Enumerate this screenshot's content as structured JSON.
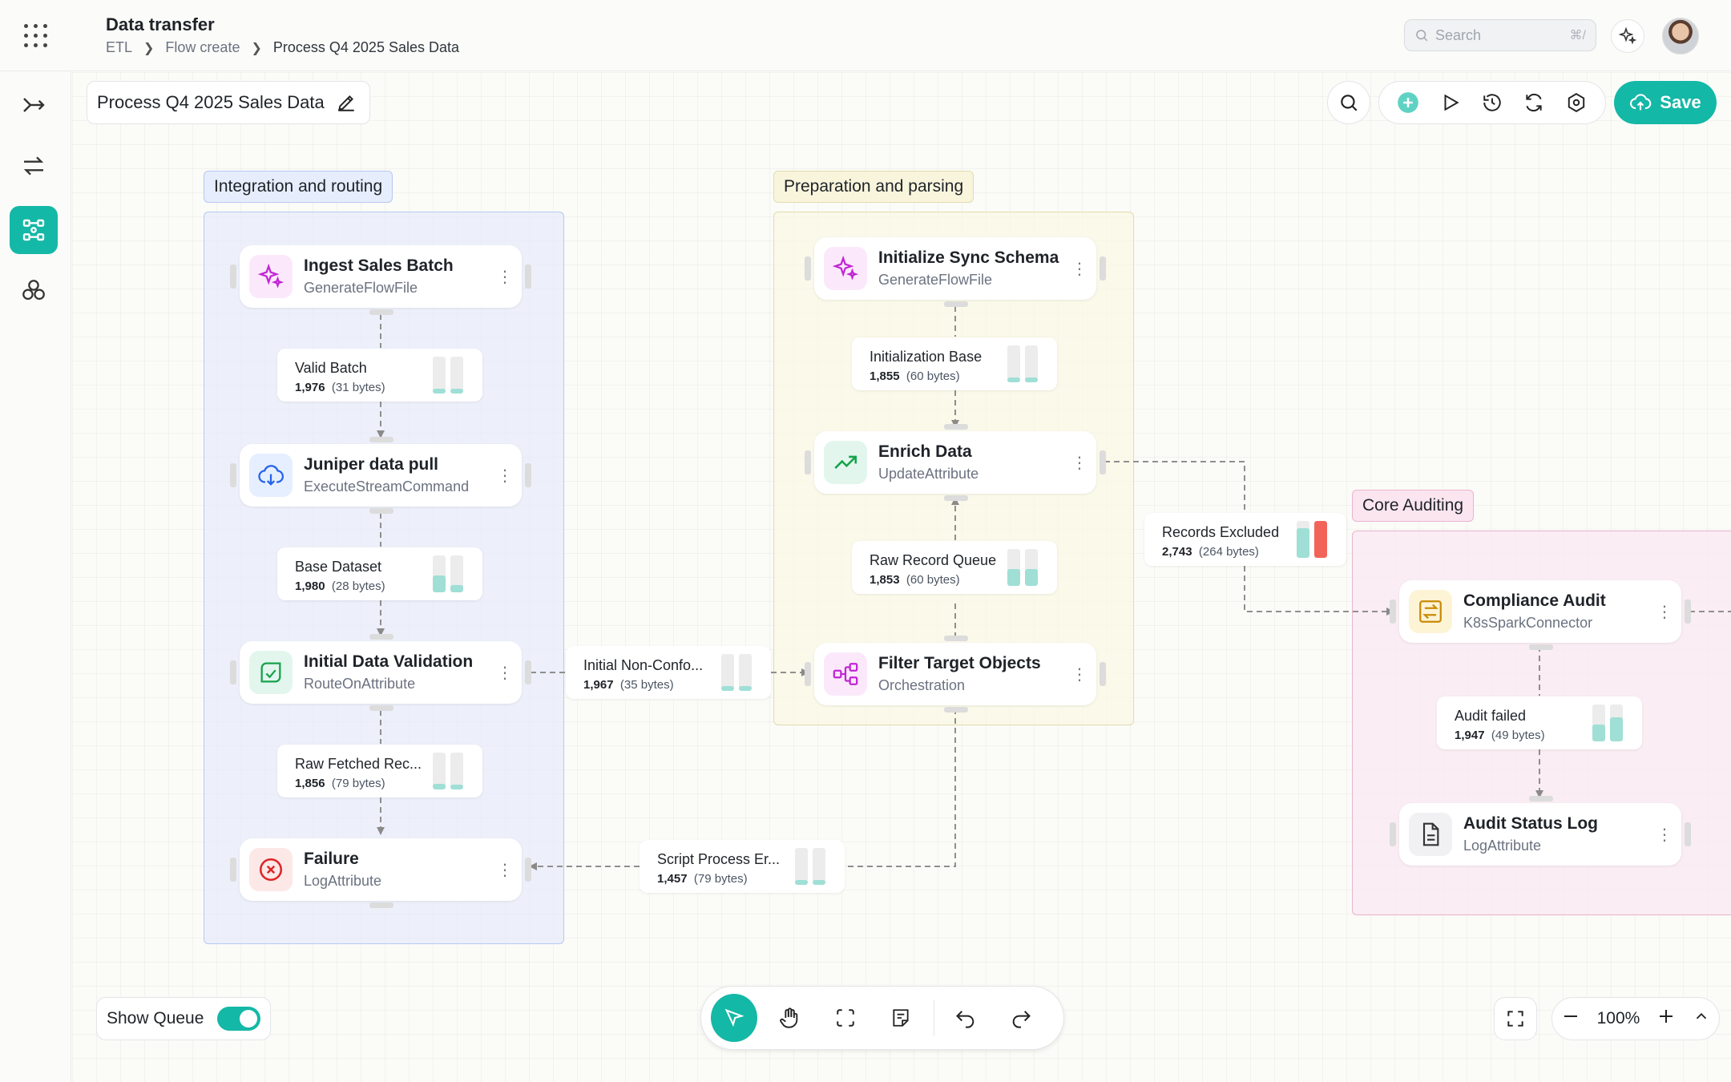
{
  "header": {
    "title": "Data transfer",
    "breadcrumb": [
      "ETL",
      "Flow create",
      "Process Q4 2025 Sales Data"
    ],
    "search_placeholder": "Search",
    "search_shortcut": "⌘/"
  },
  "flow_name": "Process Q4 2025 Sales Data",
  "toolbar": {
    "save_label": "Save"
  },
  "groups": [
    {
      "label": "Integration and routing"
    },
    {
      "label": "Preparation and parsing"
    },
    {
      "label": "Core Auditing"
    }
  ],
  "nodes": [
    {
      "name": "Ingest Sales Batch",
      "type": "GenerateFlowFile",
      "icon": "sparkles-icon"
    },
    {
      "name": "Juniper data pull",
      "type": "ExecuteStreamCommand",
      "icon": "cloud-download-icon"
    },
    {
      "name": "Initial Data Validation",
      "type": "RouteOnAttribute",
      "icon": "route-icon"
    },
    {
      "name": "Failure",
      "type": "LogAttribute",
      "icon": "x-circle-icon"
    },
    {
      "name": "Initialize Sync Schema",
      "type": "GenerateFlowFile",
      "icon": "sparkles-icon"
    },
    {
      "name": "Enrich Data",
      "type": "UpdateAttribute",
      "icon": "trending-up-icon"
    },
    {
      "name": "Filter Target Objects",
      "type": "Orchestration",
      "icon": "hierarchy-icon"
    },
    {
      "name": "Compliance Audit",
      "type": "K8sSparkConnector",
      "icon": "swap-icon"
    },
    {
      "name": "Audit Status Log",
      "type": "LogAttribute",
      "icon": "document-icon"
    }
  ],
  "queues": [
    {
      "name": "Valid Batch",
      "count": "1,976",
      "size": "(31 bytes)",
      "level": [
        0.12,
        0.12
      ]
    },
    {
      "name": "Base Dataset",
      "count": "1,980",
      "size": "(28 bytes)",
      "level": [
        0.45,
        0.2
      ]
    },
    {
      "name": "Raw Fetched Rec...",
      "count": "1,856",
      "size": "(79 bytes)",
      "level": [
        0.15,
        0.12
      ]
    },
    {
      "name": "Initialization Base",
      "count": "1,855",
      "size": "(60 bytes)",
      "level": [
        0.12,
        0.12
      ]
    },
    {
      "name": "Raw Record Queue",
      "count": "1,853",
      "size": "(60 bytes)",
      "level": [
        0.45,
        0.45
      ]
    },
    {
      "name": "Initial Non-Confo...",
      "count": "1,967",
      "size": "(35 bytes)",
      "level": [
        0.12,
        0.12
      ]
    },
    {
      "name": "Script Process Er...",
      "count": "1,457",
      "size": "(79 bytes)",
      "level": [
        0.12,
        0.12
      ]
    },
    {
      "name": "Records Excluded",
      "count": "2,743",
      "size": "(264 bytes)",
      "level": [
        0.8,
        1.0
      ]
    },
    {
      "name": "Audit failed",
      "count": "1,947",
      "size": "(49 bytes)",
      "level": [
        0.45,
        0.65
      ]
    }
  ],
  "show_queue": {
    "label": "Show Queue",
    "on": true
  },
  "zoom": {
    "level": "100%"
  },
  "colors": {
    "accent": "#14b8a6",
    "queue_fill": "#9fdfd6",
    "queue_alert": "#f2645a"
  }
}
